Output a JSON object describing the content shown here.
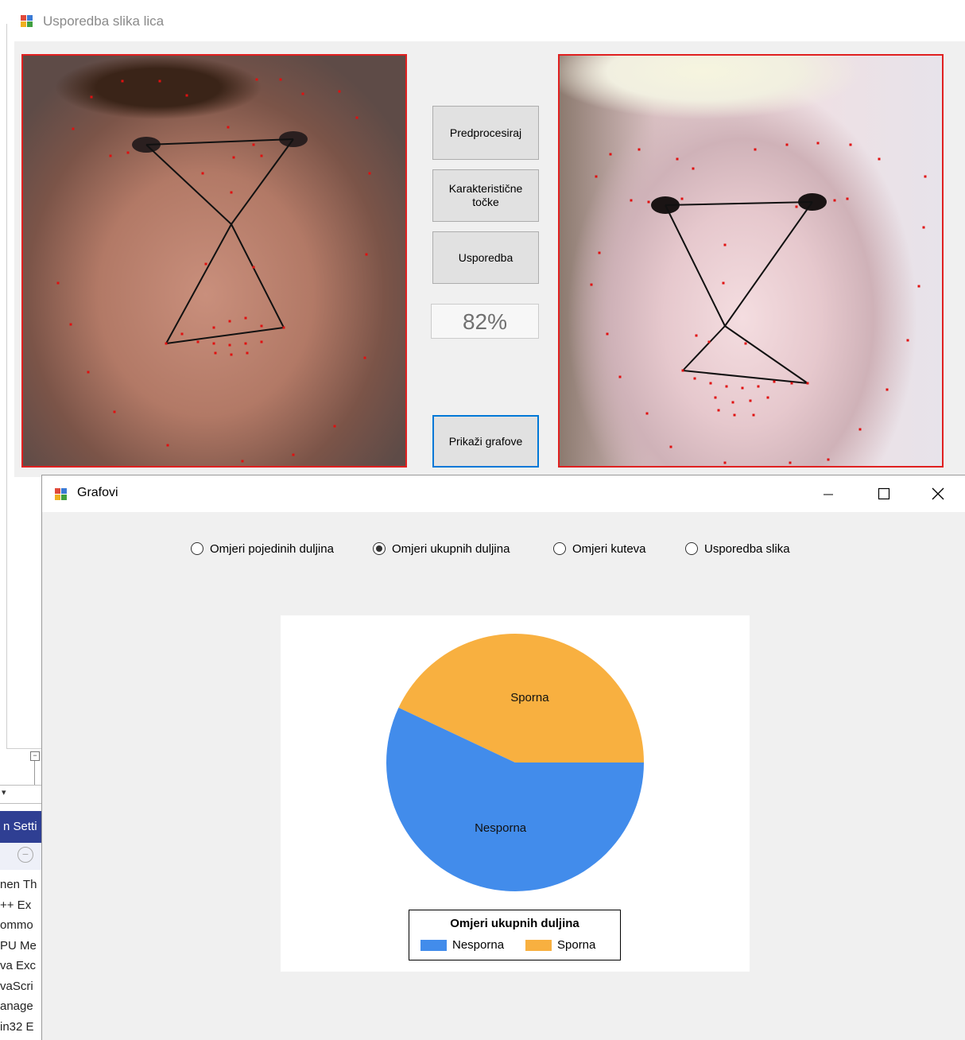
{
  "main_window": {
    "title": "Usporedba slika lica",
    "buttons": {
      "preprocess": "Predprocesiraj",
      "keypoints": "Karakteristične točke",
      "compare": "Usporedba",
      "show_graphs": "Prikaži grafove"
    },
    "result": "82%"
  },
  "graph_window": {
    "title": "Grafovi",
    "radio_options": [
      {
        "label": "Omjeri pojedinih duljina",
        "checked": false
      },
      {
        "label": "Omjeri ukupnih duljina",
        "checked": true
      },
      {
        "label": "Omjeri kuteva",
        "checked": false
      },
      {
        "label": "Usporedba slika",
        "checked": false
      }
    ]
  },
  "chart_data": {
    "type": "pie",
    "title": "Omjeri ukupnih duljina",
    "slices": [
      {
        "label": "Sporna",
        "value": 43,
        "color": "#F8B040"
      },
      {
        "label": "Nesporna",
        "value": 57,
        "color": "#428CEB"
      }
    ],
    "legend": [
      "Nesporna",
      "Sporna"
    ],
    "legend_position": "bottom"
  },
  "background_window": {
    "header_text": "n Setti",
    "list_items": [
      "nen Th",
      "++ Ex",
      "ommo",
      "PU Me",
      "va Exc",
      "vaScri",
      "anage",
      "in32 E"
    ]
  },
  "colors": {
    "photo_border": "#e02020",
    "landmark": "#e01010",
    "focus_border": "#0078d7",
    "vs_header": "#2f3f93"
  }
}
